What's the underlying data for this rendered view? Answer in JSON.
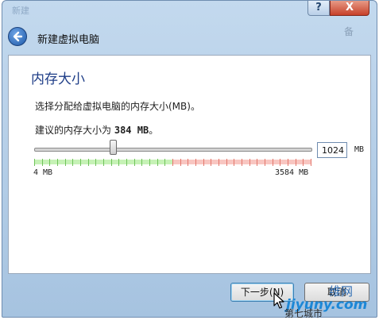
{
  "window": {
    "title": "新建虚拟电脑",
    "bg_text_right": "备",
    "bg_text_left": "新建",
    "help_label": "?",
    "close_label": "X"
  },
  "page": {
    "title": "内存大小",
    "description": "选择分配给虚拟电脑的内存大小(MB)。",
    "recommend_prefix": "建议的内存大小为",
    "recommend_value": "384 MB",
    "recommend_suffix": "。"
  },
  "memory": {
    "value": "1024",
    "unit": "MB",
    "min_label": "4 MB",
    "max_label": "3584 MB",
    "min_mb": 4,
    "max_mb": 3584,
    "recommended_mb": 384,
    "selected_mb": 1024,
    "green_until_mb": 1790
  },
  "buttons": {
    "next": "下一步(N)",
    "cancel": "取消"
  },
  "watermark": {
    "top": "维网",
    "mid": "jiyuny.com",
    "bottom": "第七城市"
  },
  "colors": {
    "accent_title": "#1e3d87",
    "band_green": "#c6f2b6",
    "band_red": "#f8c6c1",
    "tick_green": "#6fc35a",
    "tick_red": "#e3776c"
  },
  "icons": {
    "back": "back-arrow-icon",
    "cursor": "mouse-pointer-icon"
  }
}
